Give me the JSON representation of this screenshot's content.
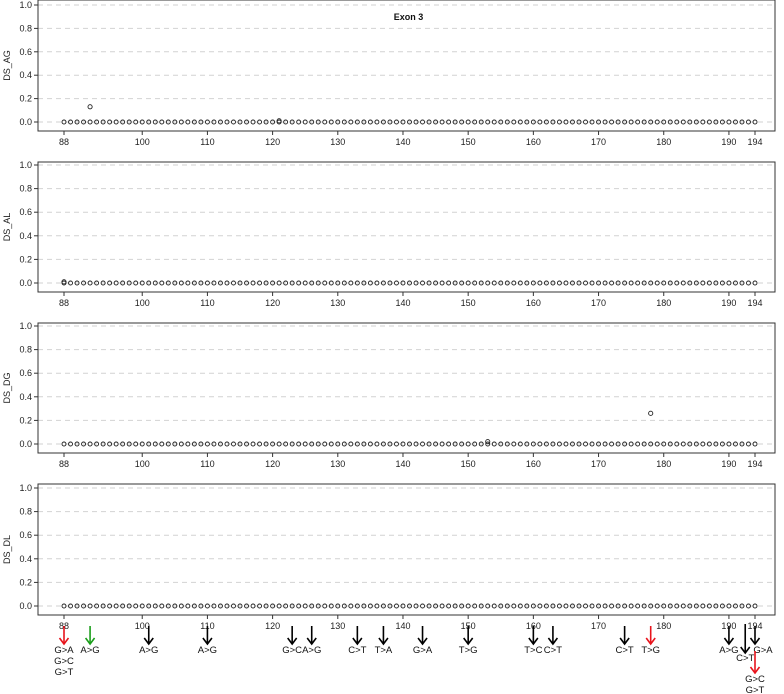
{
  "chart_data": [
    {
      "type": "scatter",
      "title": "Exon 3",
      "ylabel": "DS_AG",
      "xlim": [
        88,
        194
      ],
      "ylim": [
        0,
        1
      ],
      "x_ticks": [
        88,
        100,
        110,
        120,
        130,
        140,
        150,
        160,
        170,
        180,
        190,
        194
      ],
      "y_ticks": [
        "0.0",
        "0.2",
        "0.4",
        "0.6",
        "0.8",
        "1.0"
      ],
      "grid": "dashed horizontal",
      "baseline": 0.0,
      "points": [
        {
          "x": 92,
          "y": 0.13
        },
        {
          "x": 121,
          "y": 0.01
        }
      ]
    },
    {
      "type": "scatter",
      "title": "",
      "ylabel": "DS_AL",
      "xlim": [
        88,
        194
      ],
      "ylim": [
        0,
        1
      ],
      "x_ticks": [
        88,
        100,
        110,
        120,
        130,
        140,
        150,
        160,
        170,
        180,
        190,
        194
      ],
      "y_ticks": [
        "0.0",
        "0.2",
        "0.4",
        "0.6",
        "0.8",
        "1.0"
      ],
      "grid": "dashed horizontal",
      "baseline": 0.0,
      "points": [
        {
          "x": 88,
          "y": 0.01
        }
      ]
    },
    {
      "type": "scatter",
      "title": "",
      "ylabel": "DS_DG",
      "xlim": [
        88,
        194
      ],
      "ylim": [
        0,
        1
      ],
      "x_ticks": [
        88,
        100,
        110,
        120,
        130,
        140,
        150,
        160,
        170,
        180,
        190,
        194
      ],
      "y_ticks": [
        "0.0",
        "0.2",
        "0.4",
        "0.6",
        "0.8",
        "1.0"
      ],
      "grid": "dashed horizontal",
      "baseline": 0.0,
      "points": [
        {
          "x": 178,
          "y": 0.26
        },
        {
          "x": 153,
          "y": 0.02
        }
      ]
    },
    {
      "type": "scatter",
      "title": "",
      "ylabel": "DS_DL",
      "xlim": [
        88,
        194
      ],
      "ylim": [
        0,
        1
      ],
      "x_ticks": [
        88,
        100,
        110,
        120,
        130,
        140,
        150,
        160,
        170,
        180,
        190,
        194
      ],
      "y_ticks": [
        "0.0",
        "0.2",
        "0.4",
        "0.6",
        "0.8",
        "1.0"
      ],
      "grid": "dashed horizontal",
      "baseline": 0.0,
      "points": []
    }
  ],
  "variant_annotations": [
    {
      "x": 88,
      "color": "#e8141c",
      "labels": [
        "G>A",
        "G>C",
        "G>T"
      ]
    },
    {
      "x": 92,
      "color": "#1a9e1a",
      "labels": [
        "A>G"
      ]
    },
    {
      "x": 101,
      "color": "#000000",
      "labels": [
        "A>G"
      ]
    },
    {
      "x": 110,
      "color": "#000000",
      "labels": [
        "A>G"
      ]
    },
    {
      "x": 123,
      "color": "#000000",
      "labels": [
        "G>C"
      ]
    },
    {
      "x": 126,
      "color": "#000000",
      "labels": [
        "A>G"
      ]
    },
    {
      "x": 133,
      "color": "#000000",
      "labels": [
        "C>T"
      ]
    },
    {
      "x": 137,
      "color": "#000000",
      "labels": [
        "T>A"
      ]
    },
    {
      "x": 143,
      "color": "#000000",
      "labels": [
        "G>A"
      ]
    },
    {
      "x": 150,
      "color": "#000000",
      "labels": [
        "T>G"
      ]
    },
    {
      "x": 160,
      "color": "#000000",
      "labels": [
        "T>C"
      ]
    },
    {
      "x": 163,
      "color": "#000000",
      "labels": [
        "C>T"
      ]
    },
    {
      "x": 174,
      "color": "#000000",
      "labels": [
        "C>T"
      ]
    },
    {
      "x": 178,
      "color": "#e8141c",
      "labels": [
        "T>G"
      ]
    },
    {
      "x": 190,
      "color": "#000000",
      "labels": [
        "A>G"
      ]
    },
    {
      "x": 192.5,
      "color": "#000000",
      "labels": [
        "C>T"
      ],
      "long": true
    },
    {
      "x": 194,
      "color": "#000000",
      "labels": [
        "G>A"
      ]
    },
    {
      "x": 194,
      "color": "#e8141c",
      "labels": [
        "G>C",
        "G>T"
      ],
      "below": true
    }
  ]
}
